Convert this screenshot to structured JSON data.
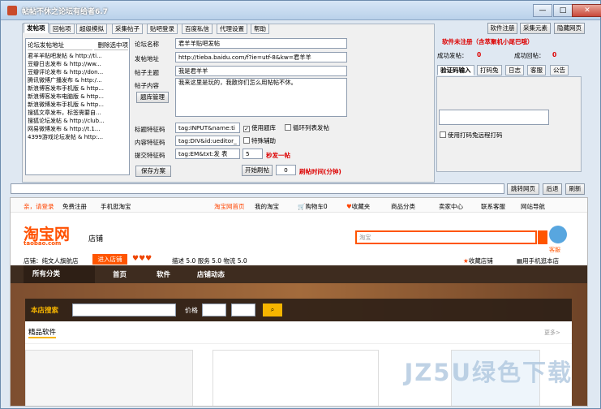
{
  "window": {
    "title": "帖帖不休之论坛有给者6.7"
  },
  "left_tabs": [
    "发帖项",
    "回帖项",
    "超级模拟",
    "采集帖子",
    "贴吧登录",
    "百度私信",
    "代理设置",
    "帮助"
  ],
  "list_header": {
    "address": "论坛发帖地址",
    "remove": "删除选中项"
  },
  "forum_list": [
    "君羊羊贴吧发帖 & http://ti...",
    "豆瓣日志发布 & http://ww...",
    "豆瓣评论发布 & http://don...",
    "腾讯微博广播发布 & http:/...",
    "新浪博客发布手机版 & http...",
    "新浪博客发布电脑版 & http...",
    "新浪微博发布手机版 & http...",
    "搜狐文章发布，标签需要自...",
    "搜狐论坛发帖 & http://club...",
    "网易微博发布 & http://t.1...",
    "4399游戏论坛发帖 & http:..."
  ],
  "form": {
    "forum_name_label": "论坛名称",
    "forum_name": "君羊羊贴吧发帖",
    "post_url_label": "发帖地址",
    "post_url": "http://tieba.baidu.com/f?ie=utf-8&kw=君羊羊",
    "subject_label": "帖子主题",
    "subject": "我是君羊羊",
    "content_label": "帖子内容",
    "content": "我来这里是玩的，我散你们怎么用帖帖不休。",
    "library_button": "题库管理",
    "title_code_label": "标题特征码",
    "title_code": "tag:INPUT&name:ti",
    "content_code_label": "内容特征码",
    "content_code": "tag:DIV&id:ueditor_",
    "submit_code_label": "提交特征码",
    "submit_code": "tag:EM&txt:发 表",
    "use_library": "使用题库",
    "loop_list": "循环列表发帖",
    "special_assist": "特殊辅助",
    "seconds_value": "5",
    "seconds_text": "秒发一帖",
    "save_button": "保存方案",
    "start_button": "开始刷帖",
    "time_value": "0",
    "time_text": "刷帖时间(分钟)"
  },
  "right_buttons": [
    "软件注册",
    "采集元素",
    "隐藏网页"
  ],
  "status": {
    "unregistered": "软件未注册（含萃聚机小尾巴哦）",
    "success_post_label": "成功发帖：",
    "success_post_value": "0",
    "success_reply_label": "成功回帖：",
    "success_reply_value": "0"
  },
  "right_tabs": [
    "验证码输入",
    "打码兔",
    "日志",
    "客服",
    "公告"
  ],
  "captcha": {
    "remote": "使用打码兔远程打码"
  },
  "nav_buttons": [
    "跳转网页",
    "后退",
    "刷新"
  ],
  "taobao": {
    "topbar_left": [
      "亲，请登录",
      "免费注册",
      "手机逛淘宝"
    ],
    "topbar_right": [
      "淘宝网首页",
      "我的淘宝",
      "购物车0",
      "收藏夹",
      "商品分类",
      "卖家中心",
      "联系客服",
      "网站导航"
    ],
    "logo": "淘宝网",
    "logo_sub": "taobao.com",
    "store_label": "店铺",
    "search_placeholder": "淘宝",
    "service": "客服",
    "shop_name": "店铺：纯文人旗航店",
    "enter_store": "进入店铺",
    "ratings": "描述 5.0  服务 5.0  物流 5.0",
    "favorite_store": "收藏店铺",
    "mobile_store": "用手机逛本店",
    "menu": [
      "所有分类",
      "首页",
      "软件",
      "店铺动态"
    ],
    "store_search": "本店搜索",
    "price": "价格",
    "content_title": "精品软件",
    "more": "更多>"
  },
  "watermark": "JZ5U绿色下载",
  "colors": {
    "accent_red": "#d00000",
    "taobao_orange": "#ff5500",
    "brown": "#3e2c1f"
  }
}
